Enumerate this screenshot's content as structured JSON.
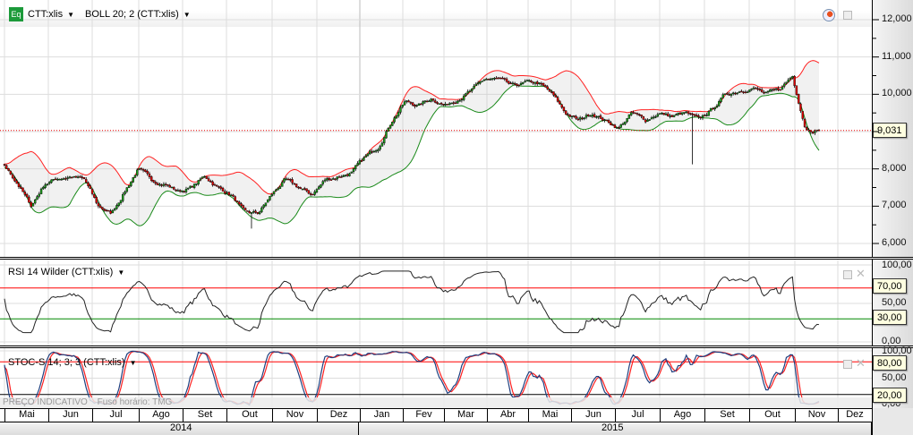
{
  "header": {
    "symbol_icon": "Eq",
    "symbol": "CTT:xlis",
    "indicator": "BOLL 20; 2 (CTT:xlis)",
    "icons": [
      "clock-icon",
      "restore-icon"
    ]
  },
  "price_axis": {
    "labels": [
      "12,000",
      "11,000",
      "10,000",
      "9,000",
      "8,000",
      "7,000",
      "6,000"
    ],
    "last_price": "9,031"
  },
  "rsi": {
    "title": "RSI 14 Wilder (CTT:xlis)",
    "labels": [
      "100,00",
      "50,00",
      "0,00"
    ],
    "upper": "70,00",
    "lower": "30,00"
  },
  "stoch": {
    "title": "STOC-S 14; 3; 3 (CTT:xlis)",
    "labels": [
      "100,00",
      "50,00",
      "0,00"
    ],
    "upper": "80,00",
    "lower": "20,00"
  },
  "footer": {
    "note": "PREÇO INDICATIVO",
    "timezone": "Fuso horário: TMG"
  },
  "time_axis": {
    "months": [
      "Mai",
      "Jun",
      "Jul",
      "Ago",
      "Set",
      "Out",
      "Nov",
      "Dez",
      "Jan",
      "Fev",
      "Mar",
      "Abr",
      "Mai",
      "Jun",
      "Jul",
      "Ago",
      "Set",
      "Out",
      "Nov",
      "Dez"
    ],
    "years": [
      "2014",
      "2015"
    ]
  },
  "colors": {
    "up": "#1a9a1a",
    "down": "#e00000",
    "boll_upper": "#ff2020",
    "boll_lower": "#1a8a1a",
    "stoch_k": "#1f3f7f",
    "stoch_d": "#ff2020"
  },
  "chart_data": {
    "type": "candlestick",
    "title": "CTT:xlis",
    "x_range": [
      "2014-05",
      "2015-11"
    ],
    "ylim": [
      6000,
      12000
    ],
    "weekly_close_anchors": [
      8050,
      7600,
      7000,
      7600,
      7750,
      7800,
      7700,
      7000,
      6800,
      7400,
      8000,
      7700,
      7600,
      7400,
      7500,
      7800,
      7500,
      7300,
      6800,
      6800,
      7300,
      7700,
      7500,
      7300,
      7700,
      7800,
      7900,
      8300,
      8600,
      9300,
      9800,
      9700,
      9900,
      9700,
      9900,
      10100,
      10400,
      10400,
      10200,
      10300,
      10300,
      10000,
      9500,
      9300,
      9500,
      9300,
      9100,
      9500,
      9300,
      9500,
      9400,
      9500,
      9300,
      9600,
      10000,
      10100,
      10200,
      10000,
      10100,
      10500,
      9100,
      9031
    ],
    "last": 9031,
    "indicators": {
      "bollinger": {
        "period": 20,
        "stdev": 2
      },
      "rsi": {
        "period": 14,
        "levels": [
          30,
          70
        ]
      },
      "stochastic": {
        "k": 14,
        "d": 3,
        "smooth": 3,
        "levels": [
          20,
          80
        ]
      }
    }
  }
}
